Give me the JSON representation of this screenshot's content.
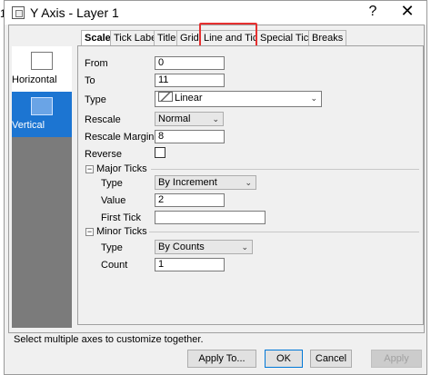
{
  "window": {
    "title": "Y Axis - Layer 1",
    "help": "?",
    "close": "✕",
    "edge_digit": "1"
  },
  "sidebar": {
    "items": [
      {
        "label": "Horizontal",
        "selected": false
      },
      {
        "label": "Vertical",
        "selected": true
      }
    ]
  },
  "tabs": [
    "Scale",
    "Tick Labels",
    "Title",
    "Grids",
    "Line and Ticks",
    "Special Ticks",
    "Breaks"
  ],
  "active_tab": "Scale",
  "form": {
    "from_label": "From",
    "from_value": "0",
    "to_label": "To",
    "to_value": "11",
    "type_label": "Type",
    "type_value": "Linear",
    "rescale_label": "Rescale",
    "rescale_value": "Normal",
    "rescale_margin_label": "Rescale Margin(%)",
    "rescale_margin_value": "8",
    "reverse_label": "Reverse",
    "major_ticks": {
      "label": "Major Ticks",
      "type_label": "Type",
      "type_value": "By Increment",
      "value_label": "Value",
      "value_value": "2",
      "first_tick_label": "First Tick",
      "first_tick_value": ""
    },
    "minor_ticks": {
      "label": "Minor Ticks",
      "type_label": "Type",
      "type_value": "By Counts",
      "count_label": "Count",
      "count_value": "1"
    }
  },
  "footer": {
    "hint": "Select multiple axes to customize together.",
    "apply_to": "Apply To...",
    "ok": "OK",
    "cancel": "Cancel",
    "apply": "Apply"
  },
  "colors": {
    "selected_sidebar": "#1c75d2",
    "highlight_box": "#e63030"
  }
}
